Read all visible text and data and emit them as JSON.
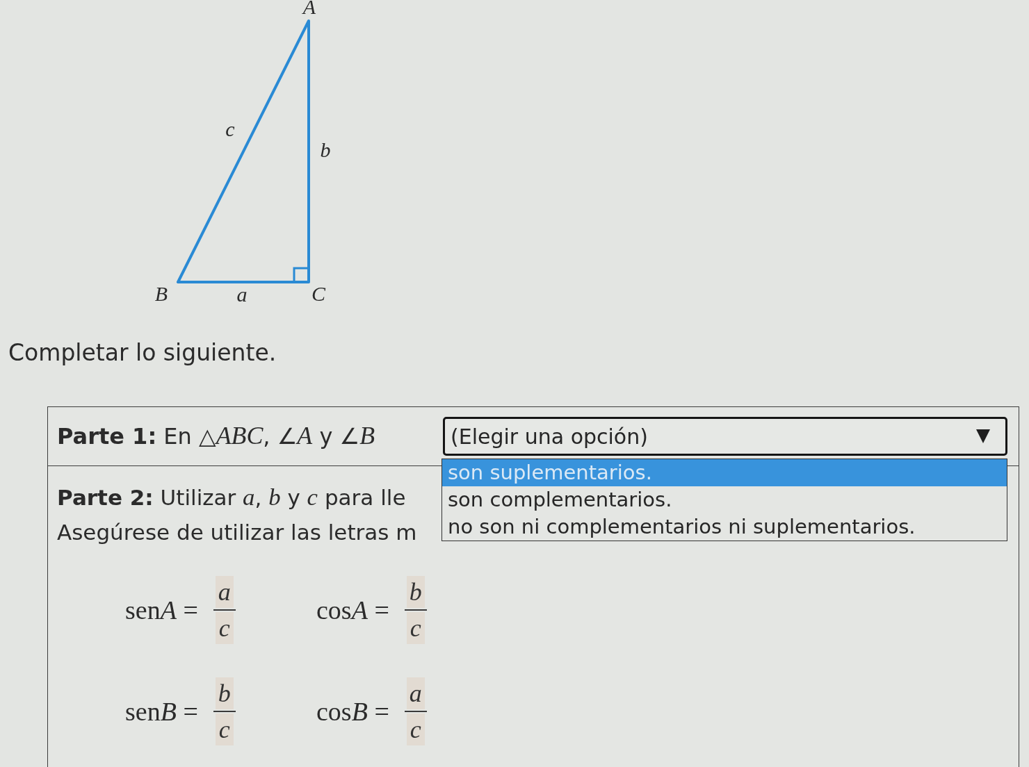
{
  "figure": {
    "vertex_labels": [
      "A",
      "B",
      "C"
    ],
    "side_labels": [
      "a",
      "b",
      "c"
    ]
  },
  "instruction": "Completar lo siguiente.",
  "part1": {
    "text": "**Parte 1:** En △*ABC*, ∠*A* y ∠*B*",
    "dropdown": {
      "placeholder": "(Elegir una opción)",
      "expanded": true,
      "options": [
        {
          "label": "son suplementarios.",
          "selected": true
        },
        {
          "label": "son complementarios.",
          "selected": false
        },
        {
          "label": "no son ni complementarios ni suplementarios.",
          "selected": false
        }
      ]
    }
  },
  "part2": {
    "lines": [
      "**Parte 2:** Utilizar *a*, *b* y *c* para lle",
      "Asegúrese de utilizar las letras m"
    ],
    "formulas": [
      {
        "function": "sen",
        "angle": "A",
        "sign": "=",
        "numerator": "a",
        "denominator": "c"
      },
      {
        "function": "cos",
        "angle": "A",
        "sign": "=",
        "numerator": "b",
        "denominator": "c"
      },
      {
        "function": "sen",
        "angle": "B",
        "sign": "=",
        "numerator": "b",
        "denominator": "c"
      },
      {
        "function": "cos",
        "angle": "B",
        "sign": "=",
        "numerator": "a",
        "denominator": "c"
      }
    ]
  }
}
